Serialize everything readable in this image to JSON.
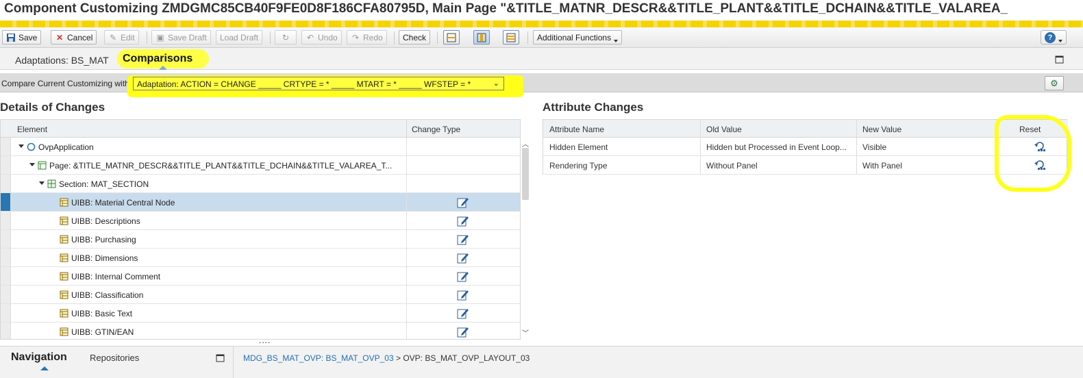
{
  "window": {
    "title": "Component Customizing ZMDGMC85CB40F9FE0D8F186CFA80795D, Main Page \"&TITLE_MATNR_DESCR&&TITLE_PLANT&&TITLE_DCHAIN&&TITLE_VALAREA_"
  },
  "toolbar": {
    "save": "Save",
    "cancel": "Cancel",
    "edit": "Edit",
    "save_draft": "Save Draft",
    "load_draft": "Load Draft",
    "undo": "Undo",
    "redo": "Redo",
    "check": "Check",
    "additional_functions": "Additional Functions",
    "help": "?"
  },
  "tabs": {
    "adaptations": "Adaptations: BS_MAT",
    "comparisons": "Comparisons"
  },
  "compare": {
    "label": "Compare Current Customizing with:",
    "selected": "Adaptation: ACTION = CHANGE _____ CRTYPE = * _____ MTART = * _____ WFSTEP = *"
  },
  "details": {
    "title": "Details of Changes",
    "col_element": "Element",
    "col_change_type": "Change Type",
    "rows": [
      {
        "label": "OvpApplication",
        "level": 0,
        "icon": "circle-icon",
        "expandable": true,
        "changed": false,
        "selected": false
      },
      {
        "label": "Page: &TITLE_MATNR_DESCR&&TITLE_PLANT&&TITLE_DCHAIN&&TITLE_VALAREA_T...",
        "level": 1,
        "icon": "page-icon",
        "expandable": true,
        "changed": false,
        "selected": false
      },
      {
        "label": "Section: MAT_SECTION",
        "level": 2,
        "icon": "section-icon",
        "expandable": true,
        "changed": false,
        "selected": false
      },
      {
        "label": "UIBB: Material Central Node",
        "level": 3,
        "icon": "uibb-icon",
        "expandable": false,
        "changed": true,
        "selected": true
      },
      {
        "label": "UIBB: Descriptions",
        "level": 3,
        "icon": "uibb-icon",
        "expandable": false,
        "changed": true,
        "selected": false
      },
      {
        "label": "UIBB: Purchasing",
        "level": 3,
        "icon": "uibb-icon",
        "expandable": false,
        "changed": true,
        "selected": false
      },
      {
        "label": "UIBB: Dimensions",
        "level": 3,
        "icon": "uibb-icon",
        "expandable": false,
        "changed": true,
        "selected": false
      },
      {
        "label": "UIBB: Internal Comment",
        "level": 3,
        "icon": "uibb-icon",
        "expandable": false,
        "changed": true,
        "selected": false
      },
      {
        "label": "UIBB: Classification",
        "level": 3,
        "icon": "uibb-icon",
        "expandable": false,
        "changed": true,
        "selected": false
      },
      {
        "label": "UIBB: Basic Text",
        "level": 3,
        "icon": "uibb-icon",
        "expandable": false,
        "changed": true,
        "selected": false
      },
      {
        "label": "UIBB: GTIN/EAN",
        "level": 3,
        "icon": "uibb-icon",
        "expandable": false,
        "changed": true,
        "selected": false
      }
    ]
  },
  "attributes": {
    "title": "Attribute Changes",
    "col_name": "Attribute Name",
    "col_old": "Old Value",
    "col_new": "New Value",
    "col_reset": "Reset",
    "rows": [
      {
        "name": "Hidden Element",
        "old": "Hidden but Processed in Event Loop...",
        "new": "Visible"
      },
      {
        "name": "Rendering Type",
        "old": "Without Panel",
        "new": "With Panel"
      }
    ]
  },
  "bottom": {
    "dots": "....",
    "navigation": "Navigation",
    "repositories": "Repositories",
    "crumb_link": "MDG_BS_MAT_OVP: BS_MAT_OVP_03",
    "crumb_sep": ">",
    "crumb_current": "OVP: BS_MAT_OVP_LAYOUT_03"
  },
  "colors": {
    "highlight": "#ffff1a",
    "selection": "#c8dced",
    "accent": "#2777b5"
  }
}
